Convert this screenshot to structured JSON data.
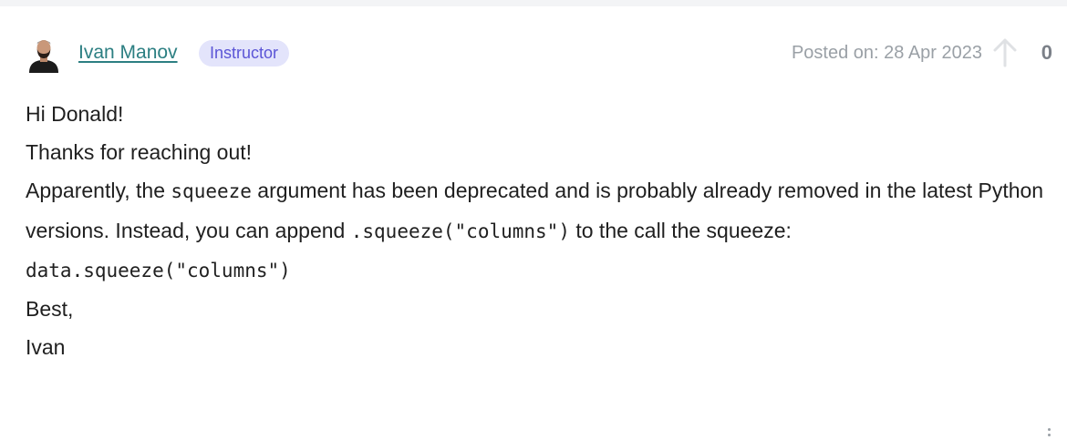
{
  "post": {
    "author": {
      "name": "Ivan Manov",
      "role_badge": "Instructor"
    },
    "posted_on": "Posted on: 28 Apr 2023",
    "vote_count": "0",
    "body": {
      "line1": "Hi Donald!",
      "line2": "Thanks for reaching out!",
      "para3_part1": "Apparently, the ",
      "para3_code1": "squeeze",
      "para3_part2": " argument has been deprecated and is probably already removed in the latest Python versions. Instead, you can append ",
      "para3_code2": ".squeeze(\"columns\")",
      "para3_part3": " to the call the squeeze:",
      "code_line": "data.squeeze(\"columns\")",
      "signoff": "Best,",
      "signature": "Ivan"
    }
  },
  "icons": {
    "upvote": "arrow-up-icon",
    "menu": "more-vertical-icon"
  },
  "colors": {
    "author_link": "#2c7f82",
    "badge_bg": "#e3e4fb",
    "badge_text": "#5b55d6",
    "muted": "#9aa0a6"
  }
}
